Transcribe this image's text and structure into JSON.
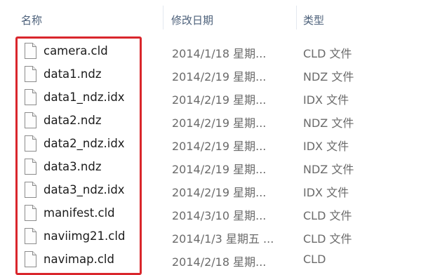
{
  "columns": {
    "name": "名称",
    "date": "修改日期",
    "type": "类型"
  },
  "files": [
    {
      "name": "camera.cld",
      "date": "2014/1/18 星期...",
      "type": "CLD 文件",
      "icon": "file-icon"
    },
    {
      "name": "data1.ndz",
      "date": "2014/2/19 星期...",
      "type": "NDZ 文件",
      "icon": "file-icon"
    },
    {
      "name": "data1_ndz.idx",
      "date": "2014/2/19 星期...",
      "type": "IDX 文件",
      "icon": "file-icon"
    },
    {
      "name": "data2.ndz",
      "date": "2014/2/19 星期...",
      "type": "NDZ 文件",
      "icon": "file-icon"
    },
    {
      "name": "data2_ndz.idx",
      "date": "2014/2/19 星期...",
      "type": "IDX 文件",
      "icon": "file-icon"
    },
    {
      "name": "data3.ndz",
      "date": "2014/2/19 星期...",
      "type": "NDZ 文件",
      "icon": "file-icon"
    },
    {
      "name": "data3_ndz.idx",
      "date": "2014/2/19 星期...",
      "type": "IDX 文件",
      "icon": "file-icon"
    },
    {
      "name": "manifest.cld",
      "date": "2014/3/10 星期...",
      "type": "CLD 文件",
      "icon": "file-icon"
    },
    {
      "name": "naviimg21.cld",
      "date": "2014/1/3 星期五 ...",
      "type": "CLD 文件",
      "icon": "file-icon"
    },
    {
      "name": "navimap.cld",
      "date": "2014/2/18 星期...",
      "type": "CLD",
      "icon": "file-icon"
    }
  ],
  "highlight_color": "#d9262c",
  "header_color": "#4c607a"
}
